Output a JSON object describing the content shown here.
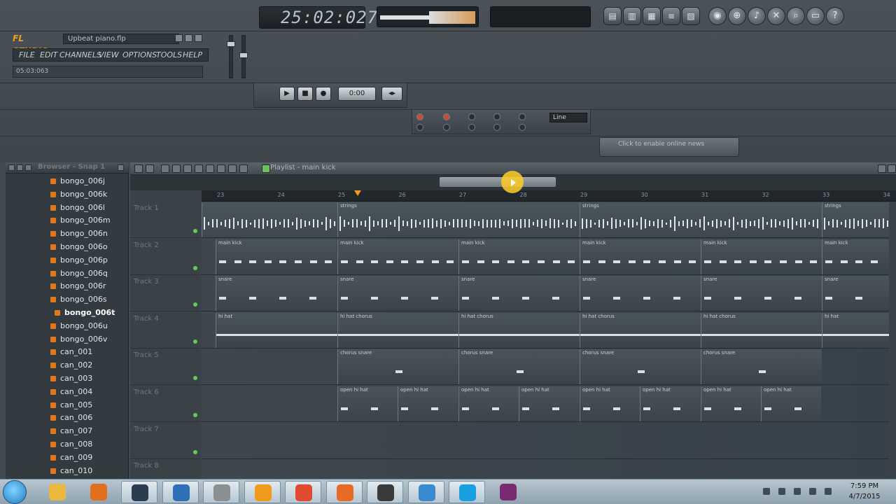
{
  "window": {
    "logo": "FL STUDIO",
    "project_name": "Upbeat piano.flp",
    "hint_text": "05:03:063",
    "time_display": "25:02:027"
  },
  "menu": {
    "items": [
      "FILE",
      "EDIT",
      "CHANNELS",
      "VIEW",
      "OPTIONS",
      "TOOLS",
      "HELP"
    ]
  },
  "recording": {
    "line_mode": "Line"
  },
  "news": {
    "label": "Click to enable online news"
  },
  "browser": {
    "title": "Browser - Snap 1",
    "files": [
      "bongo_006j",
      "bongo_006k",
      "bongo_006l",
      "bongo_006m",
      "bongo_006n",
      "bongo_006o",
      "bongo_006p",
      "bongo_006q",
      "bongo_006r",
      "bongo_006s",
      "bongo_006t",
      "bongo_006u",
      "bongo_006v",
      "can_001",
      "can_002",
      "can_003",
      "can_004",
      "can_005",
      "can_006",
      "can_007",
      "can_008",
      "can_009",
      "can_010"
    ],
    "selected_index": 10
  },
  "playlist": {
    "title": "Playlist - main kick",
    "ruler_ticks": [
      "23",
      "24",
      "25",
      "26",
      "27",
      "28",
      "29",
      "30",
      "31",
      "32",
      "33",
      "34"
    ],
    "tracks": [
      "Track 1",
      "Track 2",
      "Track 3",
      "Track 4",
      "Track 5",
      "Track 6",
      "Track 7",
      "Track 8"
    ],
    "clip_labels": {
      "strings": "strings",
      "main_kick": "main kick",
      "snare": "snare",
      "hi_hat": "hi hat",
      "hi_hat_chorus": "hi hat chorus",
      "chorus_snare": "chorus snare",
      "open_hi_hat": "open hi hat"
    }
  },
  "taskbar": {
    "time": "7:59 PM",
    "date": "4/7/2015",
    "apps": [
      "folder-icon",
      "media-player-icon",
      "hp-icon",
      "checkbox-app-icon",
      "shield-app-icon",
      "fl-studio-icon",
      "chrome-icon",
      "firefox-icon",
      "obs-icon",
      "network-icon",
      "skype-icon",
      "presentation-icon"
    ]
  }
}
